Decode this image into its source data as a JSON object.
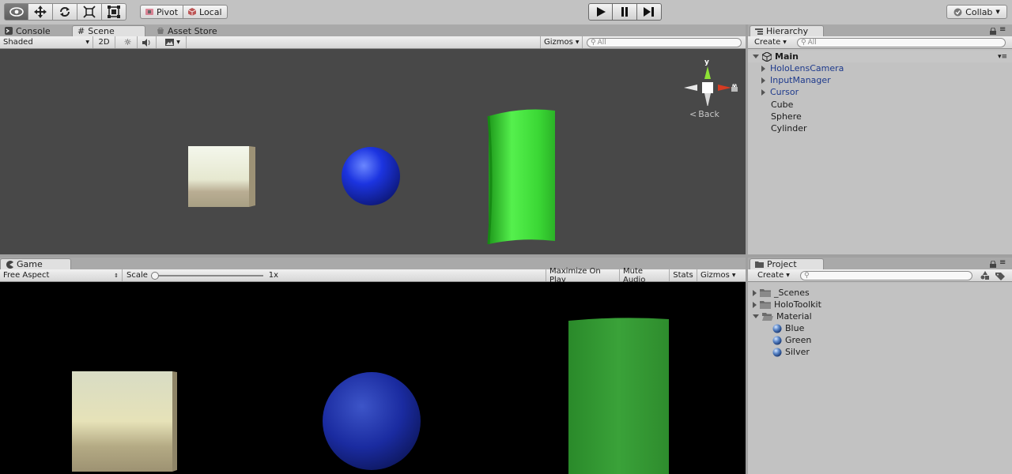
{
  "toolbar": {
    "tools": [
      "view-tool-icon",
      "move-tool-icon",
      "rotate-tool-icon",
      "scale-tool-icon",
      "rect-tool-icon"
    ],
    "pivot_label": "Pivot",
    "local_label": "Local",
    "collab_label": "Collab"
  },
  "scene_panel": {
    "tabs": [
      {
        "label": "Console"
      },
      {
        "label": "Scene"
      },
      {
        "label": "Asset Store"
      }
    ],
    "shading_mode": "Shaded",
    "mode_2d": "2D",
    "gizmos_label": "Gizmos",
    "search_placeholder": "All",
    "gizmo_axis_y": "y",
    "gizmo_axis_x": "x",
    "back_label": "Back",
    "background_color": "#484848"
  },
  "game_panel": {
    "tab_label": "Game",
    "aspect": "Free Aspect",
    "scale_label": "Scale",
    "scale_value": "1x",
    "scale_level": 0,
    "buttons": [
      "Maximize On Play",
      "Mute Audio",
      "Stats",
      "Gizmos"
    ],
    "background_color": "#000000"
  },
  "hierarchy": {
    "tab_label": "Hierarchy",
    "create_label": "Create",
    "search_placeholder": "All",
    "scene_name": "Main",
    "items": [
      {
        "label": "HoloLensCamera",
        "expandable": true,
        "prefab": true
      },
      {
        "label": "InputManager",
        "expandable": true,
        "prefab": true
      },
      {
        "label": "Cursor",
        "expandable": true,
        "prefab": true
      },
      {
        "label": "Cube",
        "expandable": false,
        "prefab": false
      },
      {
        "label": "Sphere",
        "expandable": false,
        "prefab": false
      },
      {
        "label": "Cylinder",
        "expandable": false,
        "prefab": false
      }
    ]
  },
  "project": {
    "tab_label": "Project",
    "create_label": "Create",
    "folders": [
      {
        "label": "_Scenes",
        "expanded": false
      },
      {
        "label": "HoloToolkit",
        "expanded": false
      },
      {
        "label": "Material",
        "expanded": true
      }
    ],
    "materials": [
      {
        "label": "Blue"
      },
      {
        "label": "Green"
      },
      {
        "label": "Silver"
      }
    ]
  },
  "objects": {
    "cube_color": "#e8ead6",
    "sphere_color": "#1a2fd8",
    "cylinder_color": "#3fe03a"
  }
}
